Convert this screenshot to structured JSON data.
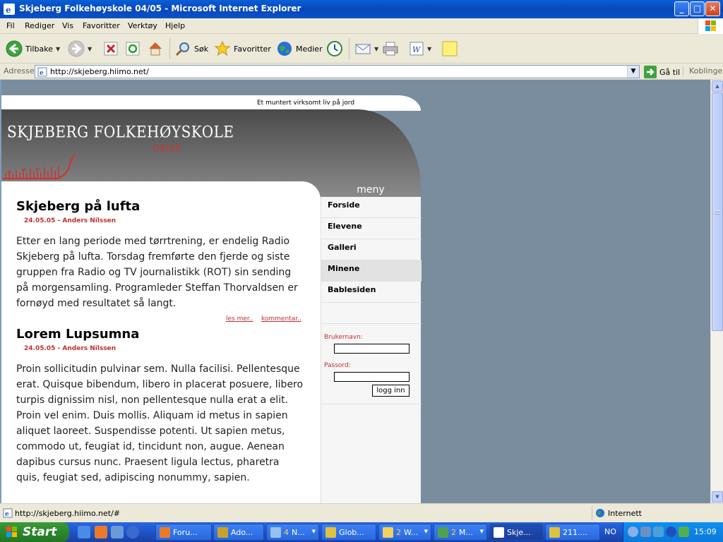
{
  "window": {
    "title": "Skjeberg Folkehøyskole 04/05 - Microsoft Internet Explorer",
    "min": "_",
    "max": "□",
    "close": "✕"
  },
  "menubar": {
    "items": [
      "Fil",
      "Rediger",
      "Vis",
      "Favoritter",
      "Verktøy",
      "Hjelp"
    ]
  },
  "toolbar": {
    "back": "Tilbake",
    "search": "Søk",
    "favorites": "Favoritter",
    "media": "Medier"
  },
  "address": {
    "label": "Adresse",
    "url": "http://skjeberg.hiimo.net/",
    "go": "Gå til",
    "links": "Koblinger"
  },
  "site": {
    "tagline": "Et muntert virksomt liv på jord",
    "title": "SKJEBERG FOLKEHØYSKOLE",
    "year": "04/05",
    "menu_header": "meny",
    "menu": [
      {
        "label": "Forside"
      },
      {
        "label": "Elevene"
      },
      {
        "label": "Galleri"
      },
      {
        "label": "Minene"
      },
      {
        "label": "Bablesiden"
      }
    ],
    "login": {
      "username_label": "Brukernavn:",
      "password_label": "Passord:",
      "button": "logg inn"
    },
    "articles": [
      {
        "title": "Skjeberg på lufta",
        "meta": "24.05.05 - Anders Nilssen",
        "body": "Etter en lang periode med tørrtrening, er endelig Radio Skjeberg på lufta. Torsdag fremførte den fjerde og siste gruppen fra Radio og TV journalistikk (ROT) sin sending på morgensamling. Programleder Steffan Thorvaldsen er fornøyd med resultatet så langt.",
        "read_more": "les mer..",
        "comment": "kommentar.."
      },
      {
        "title": "Lorem Lupsumna",
        "meta": "24.05.05 - Anders Nilssen",
        "body": "Proin sollicitudin pulvinar sem. Nulla facilisi. Pellentesque erat. Quisque bibendum, libero in placerat posuere, libero turpis dignissim nisl, non pellentesque nulla erat a elit. Proin vel enim. Duis mollis. Aliquam id metus in sapien aliquet laoreet. Suspendisse potenti. Ut sapien metus, commodo ut, feugiat id, tincidunt non, augue. Aenean dapibus cursus nunc. Praesent ligula lectus, pharetra quis, feugiat sed, adipiscing nonummy, sapien."
      }
    ]
  },
  "status": {
    "text": "http://skjeberg.hiimo.net/#",
    "zone": "Internett"
  },
  "taskbar": {
    "start": "Start",
    "tasks": [
      {
        "label": "Foru...",
        "num": ""
      },
      {
        "label": "Ado...",
        "num": ""
      },
      {
        "label": "N...",
        "num": "4"
      },
      {
        "label": "Glob...",
        "num": ""
      },
      {
        "label": "W...",
        "num": "2"
      },
      {
        "label": "M...",
        "num": "2"
      },
      {
        "label": "Skje...",
        "num": ""
      },
      {
        "label": "211....",
        "num": ""
      }
    ],
    "lang": "NO",
    "time": "15:09"
  },
  "colors": {
    "accent_red": "#c03030",
    "page_bg": "#7a8d9e",
    "xp_blue": "#245edb"
  }
}
